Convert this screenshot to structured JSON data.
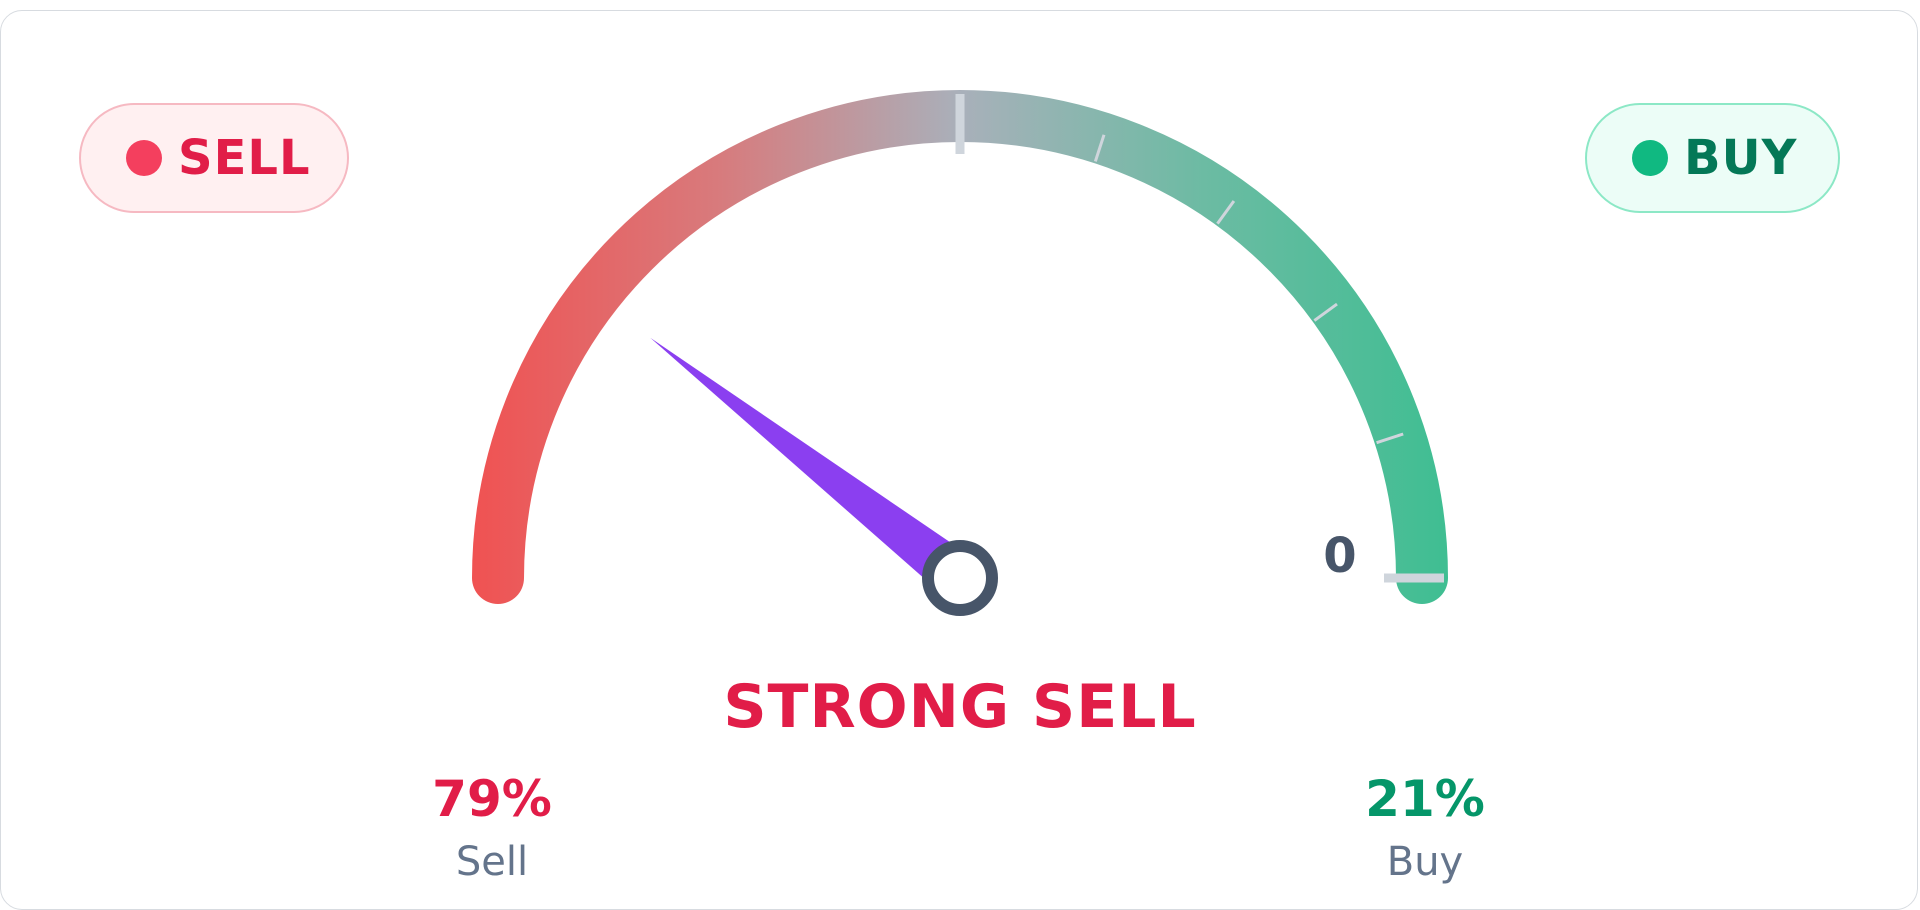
{
  "badges": {
    "sell": {
      "label": "SELL",
      "color": "#f43f5e"
    },
    "buy": {
      "label": "BUY",
      "color": "#10b981"
    }
  },
  "gauge": {
    "scale_label": "0",
    "level": 0.21,
    "colors": {
      "sell": "#f05252",
      "neutral": "#a9b0ba",
      "buy": "#3fbe92",
      "needle": "#8b3ff0",
      "hub": "#475569"
    }
  },
  "rating": {
    "label": "STRONG SELL",
    "color": "#e11d48"
  },
  "breakdown": {
    "sell": {
      "percent": "79%",
      "label": "Sell"
    },
    "buy": {
      "percent": "21%",
      "label": "Buy"
    }
  }
}
